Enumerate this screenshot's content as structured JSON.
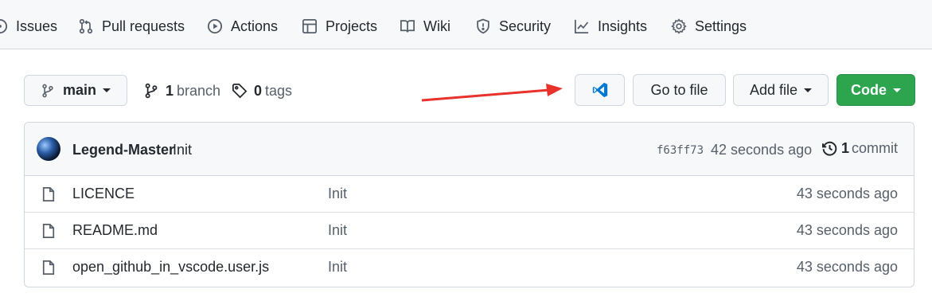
{
  "nav": {
    "items": [
      {
        "label": "Issues",
        "icon": "issue-icon"
      },
      {
        "label": "Pull requests",
        "icon": "pull-request-icon"
      },
      {
        "label": "Actions",
        "icon": "play-icon"
      },
      {
        "label": "Projects",
        "icon": "table-icon"
      },
      {
        "label": "Wiki",
        "icon": "book-icon"
      },
      {
        "label": "Security",
        "icon": "shield-icon"
      },
      {
        "label": "Insights",
        "icon": "graph-icon"
      },
      {
        "label": "Settings",
        "icon": "gear-icon"
      }
    ]
  },
  "toolbar": {
    "branch_label": "main",
    "branch_count": "1",
    "branch_word": "branch",
    "tag_count": "0",
    "tag_word": "tags",
    "vscode_icon": "vscode-icon",
    "goto_label": "Go to file",
    "addfile_label": "Add file",
    "code_label": "Code",
    "code_color": "#2da44e",
    "annotation_arrow_color": "#e8322b"
  },
  "commit": {
    "author": "Legend-Master",
    "message": "Init",
    "sha": "f63ff73",
    "time": "42 seconds ago",
    "count": "1",
    "count_word": "commit"
  },
  "files": [
    {
      "name": "LICENCE",
      "message": "Init",
      "age": "43 seconds ago",
      "icon": "file-icon"
    },
    {
      "name": "README.md",
      "message": "Init",
      "age": "43 seconds ago",
      "icon": "file-icon"
    },
    {
      "name": "open_github_in_vscode.user.js",
      "message": "Init",
      "age": "43 seconds ago",
      "icon": "file-icon"
    }
  ]
}
